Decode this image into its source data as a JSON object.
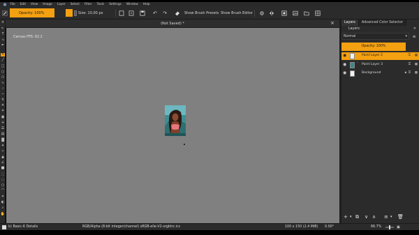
{
  "menubar": {
    "items": [
      "File",
      "Edit",
      "View",
      "Image",
      "Layer",
      "Select",
      "Filter",
      "Tools",
      "Settings",
      "Window",
      "Help"
    ]
  },
  "toolbar": {
    "opacity_label": "Opacity: 100%",
    "size_label": "Size: 10,00 px",
    "show_brush_presets": "Show Brush Presets",
    "show_brush_editor": "Show Brush Editor"
  },
  "document": {
    "title": "(Not Saved)  *",
    "fps": "Canvas FPS: 62.2"
  },
  "statusbar": {
    "brush": "b) Basic-6 Details",
    "color_space": "RGB/Alpha (8-bit integer/channel)  sRGB-elle-V2-srgbtrc.icc",
    "dimensions": "100 x 150 (2.4 MiB)",
    "rotation": "0.00°",
    "zoom": "66.7%"
  },
  "dock": {
    "tabs": [
      "Layers",
      "Advanced Color Selector"
    ],
    "panel_title": "Layers",
    "blend_mode": "Normal",
    "opacity": "Opacity:  100%",
    "layers": [
      {
        "name": "Paint Layer 2",
        "selected": true,
        "thumb": "white"
      },
      {
        "name": "Paint Layer 3",
        "selected": false,
        "thumb": "picture"
      },
      {
        "name": "Background",
        "selected": false,
        "thumb": "white"
      }
    ]
  },
  "colors": {
    "accent": "#f3a011",
    "canvas": "#808080",
    "panel": "#2b2b2b"
  }
}
